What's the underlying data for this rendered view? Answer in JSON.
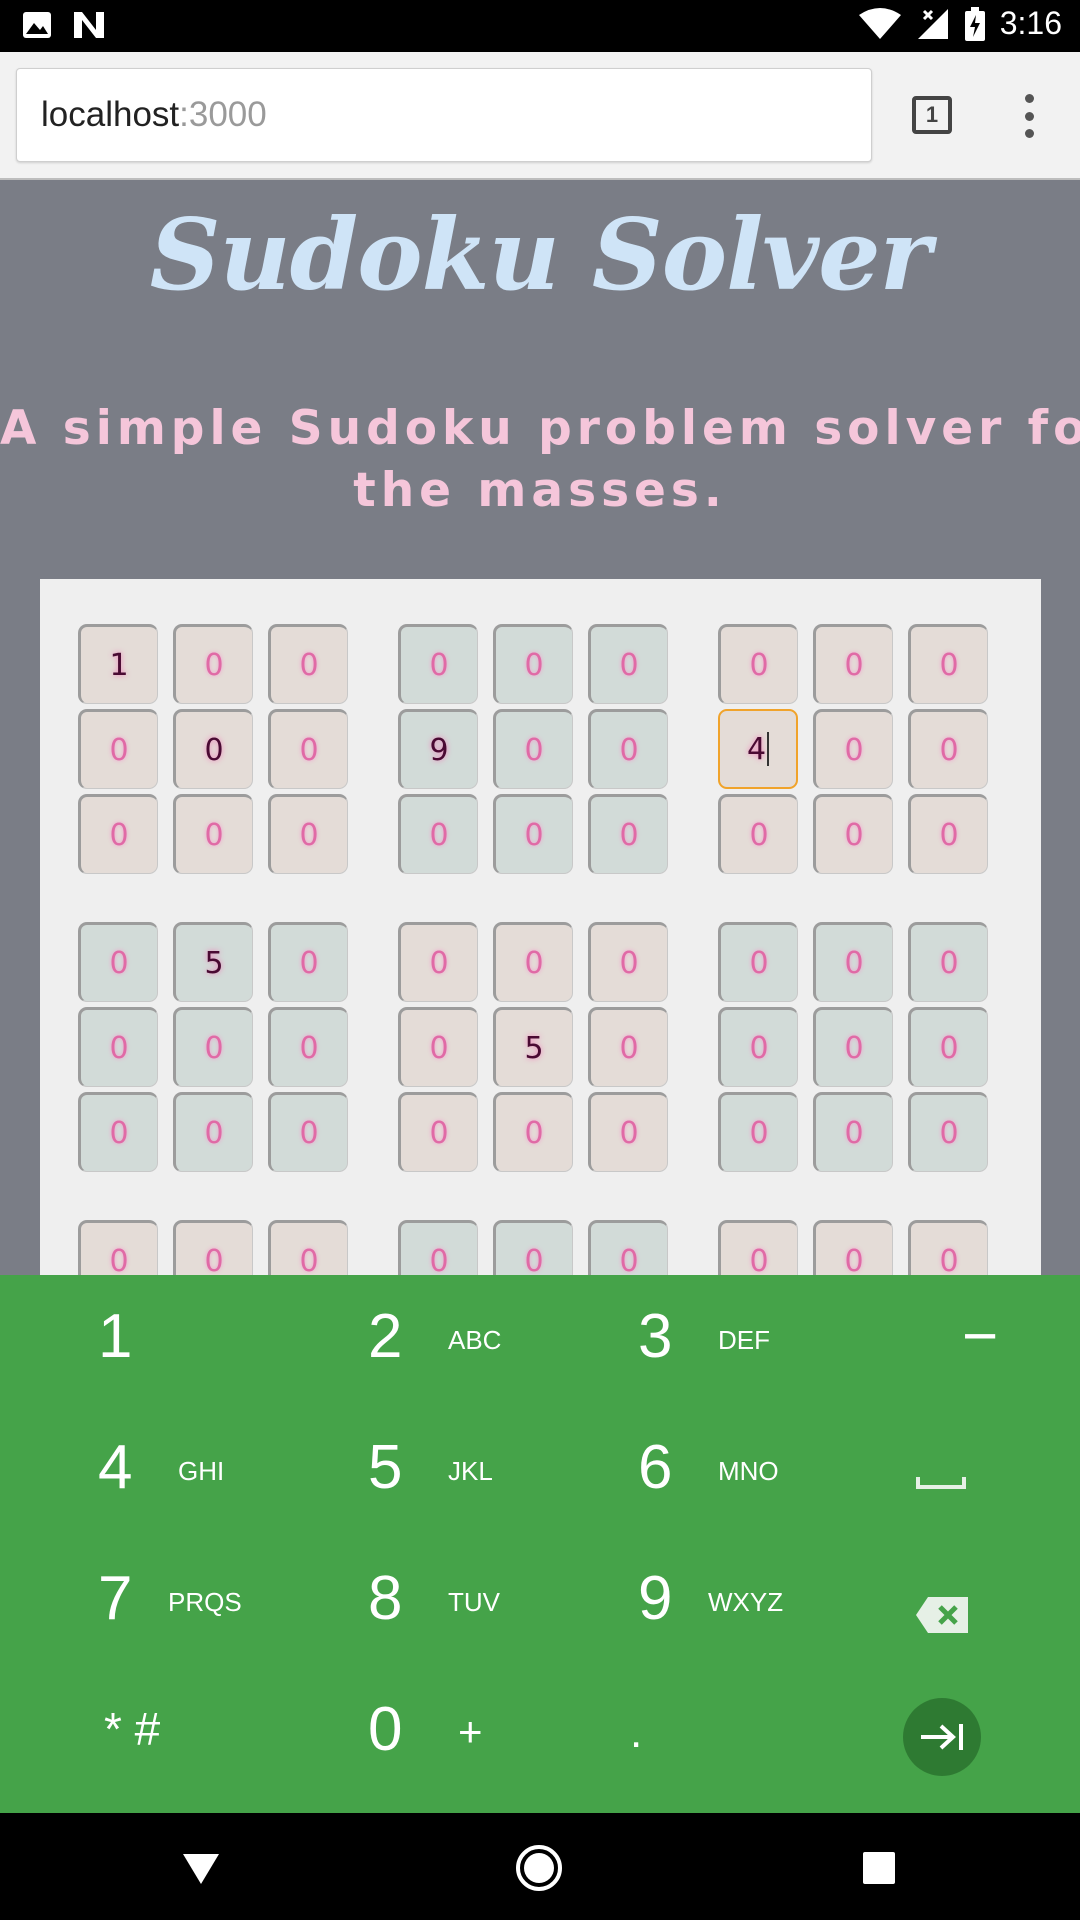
{
  "status_bar": {
    "time": "3:16",
    "left_icons": [
      "image-icon",
      "n-logo-icon"
    ],
    "right_icons": [
      "wifi-icon",
      "signal-icon",
      "battery-charging-icon"
    ]
  },
  "browser": {
    "url_host": "localhost",
    "url_port": ":3000",
    "tab_count": "1"
  },
  "page": {
    "title": "Sudoku Solver",
    "subtitle_line1": "A simple Sudoku problem solver for",
    "subtitle_line2": "the masses.",
    "grid": [
      [
        "1",
        "0",
        "0",
        "0",
        "0",
        "0",
        "0",
        "0",
        "0"
      ],
      [
        "0",
        "0",
        "0",
        "9",
        "0",
        "0",
        "4",
        "0",
        "0"
      ],
      [
        "0",
        "0",
        "0",
        "0",
        "0",
        "0",
        "0",
        "0",
        "0"
      ],
      [
        "0",
        "5",
        "0",
        "0",
        "0",
        "0",
        "0",
        "0",
        "0"
      ],
      [
        "0",
        "0",
        "0",
        "0",
        "5",
        "0",
        "0",
        "0",
        "0"
      ],
      [
        "0",
        "0",
        "0",
        "0",
        "0",
        "0",
        "0",
        "0",
        "0"
      ],
      [
        "0",
        "0",
        "0",
        "0",
        "0",
        "0",
        "0",
        "0",
        "0"
      ]
    ],
    "filled_cells": [
      [
        0,
        0
      ],
      [
        1,
        1
      ],
      [
        1,
        3
      ],
      [
        1,
        6
      ],
      [
        3,
        1
      ],
      [
        4,
        4
      ]
    ],
    "focused_cell": [
      1,
      6
    ],
    "colors": {
      "background": "#7a7d86",
      "title": "#cfe4f7",
      "subtitle": "#f5c6da",
      "cell_warm": "#e4dcd7",
      "cell_cool": "#d2dbd8",
      "focus": "#f0a32b"
    }
  },
  "keyboard": {
    "color": "#45a349",
    "keys": [
      {
        "digit": "1",
        "letters": ""
      },
      {
        "digit": "2",
        "letters": "ABC"
      },
      {
        "digit": "3",
        "letters": "DEF"
      },
      {
        "digit": "−",
        "letters": ""
      },
      {
        "digit": "4",
        "letters": "GHI"
      },
      {
        "digit": "5",
        "letters": "JKL"
      },
      {
        "digit": "6",
        "letters": "MNO"
      },
      {
        "digit": "",
        "letters": ""
      },
      {
        "digit": "7",
        "letters": "PRQS"
      },
      {
        "digit": "8",
        "letters": "TUV"
      },
      {
        "digit": "9",
        "letters": "WXYZ"
      },
      {
        "digit": "",
        "letters": ""
      },
      {
        "digit": "* #",
        "letters": ""
      },
      {
        "digit": "0",
        "letters": "+"
      },
      {
        "digit": ".",
        "letters": ""
      },
      {
        "digit": "",
        "letters": ""
      }
    ]
  },
  "nav_bar": {
    "buttons": [
      "back-icon",
      "home-icon",
      "recents-icon"
    ]
  }
}
